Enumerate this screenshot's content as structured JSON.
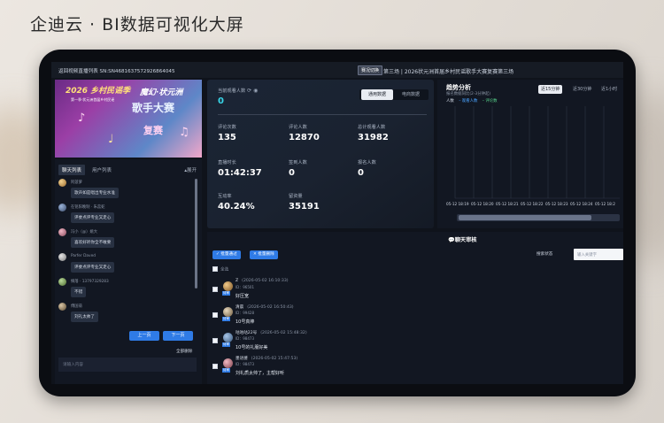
{
  "page_title": "企迪云 · BI数据可视化大屏",
  "topbar": {
    "back_text": "返回视频直播列表  SN:SN4681637572926864045",
    "switch_chip": "赛况切换",
    "event_title": "第三场 | 2026状元洲首届乡村民谣歌手大赛复赛第三场"
  },
  "banner": {
    "line1": "2026 乡村民谣季",
    "line2": "魔幻·状元洲",
    "line3": "歌手大赛",
    "line4": "复赛",
    "small": "第一季·状元洲首届乡村民谣"
  },
  "chat": {
    "tabs": [
      "聊天列表",
      "用户列表"
    ],
    "expand": "展开",
    "messages": [
      {
        "name": "阿菠萝",
        "text": "歌声如是唱出专业水准"
      },
      {
        "name": "在铭阳晚制 · 朱蕊蛇",
        "text": "评委点评专业又走心"
      },
      {
        "name": "冯小（@）姚大",
        "text": "喜欢好听你全不敢要"
      },
      {
        "name": "Parfer Daved",
        "text": "评委点评专业又走心"
      },
      {
        "name": "绸落 · 13797329283",
        "text": "不错"
      },
      {
        "name": "傅国菊",
        "text": "刘礼太帅了"
      }
    ],
    "prev": "上一页",
    "next": "下一页",
    "all_msgs": "全部删除",
    "input_placeholder": "请输入内容"
  },
  "stats": {
    "online_label": "当前观看人数",
    "online_value": "0",
    "seg_on": "通用数据",
    "seg_off": "电商数据",
    "items": [
      {
        "label": "评论次数",
        "value": "135"
      },
      {
        "label": "评论人数",
        "value": "12870"
      },
      {
        "label": "总计观看人数",
        "value": "31982"
      },
      {
        "label": "直播时长",
        "value": "01:42:37"
      },
      {
        "label": "签到人数",
        "value": "0"
      },
      {
        "label": "报名人数",
        "value": "0"
      },
      {
        "label": "互动率",
        "value": "40.24%"
      },
      {
        "label": "留资量",
        "value": "35191"
      }
    ]
  },
  "trend": {
    "title": "趋势分析",
    "subtitle": "报名数据同比(2-3分钟起)",
    "ranges": [
      "近15分钟",
      "近30分钟",
      "近1小时"
    ],
    "legend": [
      "人数",
      "观看人数",
      "评论数"
    ],
    "x_labels": [
      "05-12 18:19",
      "05-12 18:20",
      "05-12 18:21",
      "05-12 18:22",
      "05-12 18:23",
      "05-12 18:24",
      "05-12 18:2"
    ]
  },
  "review": {
    "title": "聊天审核",
    "btn_pass": "✓ 批量通过",
    "btn_delete": "✕ 批量删除",
    "filter_label": "搜索状态",
    "filter_placeholder": "输入关键字",
    "select_all": "全选",
    "items": [
      {
        "name": "Z",
        "time": "(2026-05-02 16:10:33)",
        "id": "ID：96501",
        "tag": "待审",
        "content": "好压宽"
      },
      {
        "name": "清晨",
        "time": "(2026-05-02 16:50:43)",
        "id": "ID：99428",
        "tag": "待审",
        "content": "10号真棒"
      },
      {
        "name": "咕咕咕22号",
        "time": "(2026-05-02 15:48:32)",
        "id": "ID：98473",
        "tag": "待审",
        "content": "10号的礼服好美"
      },
      {
        "name": "墨语婆",
        "time": "(2026-05-02 15:47:53)",
        "id": "ID：98473",
        "tag": "待审",
        "content": "刘礼质太帅了，主帮好听"
      }
    ]
  }
}
